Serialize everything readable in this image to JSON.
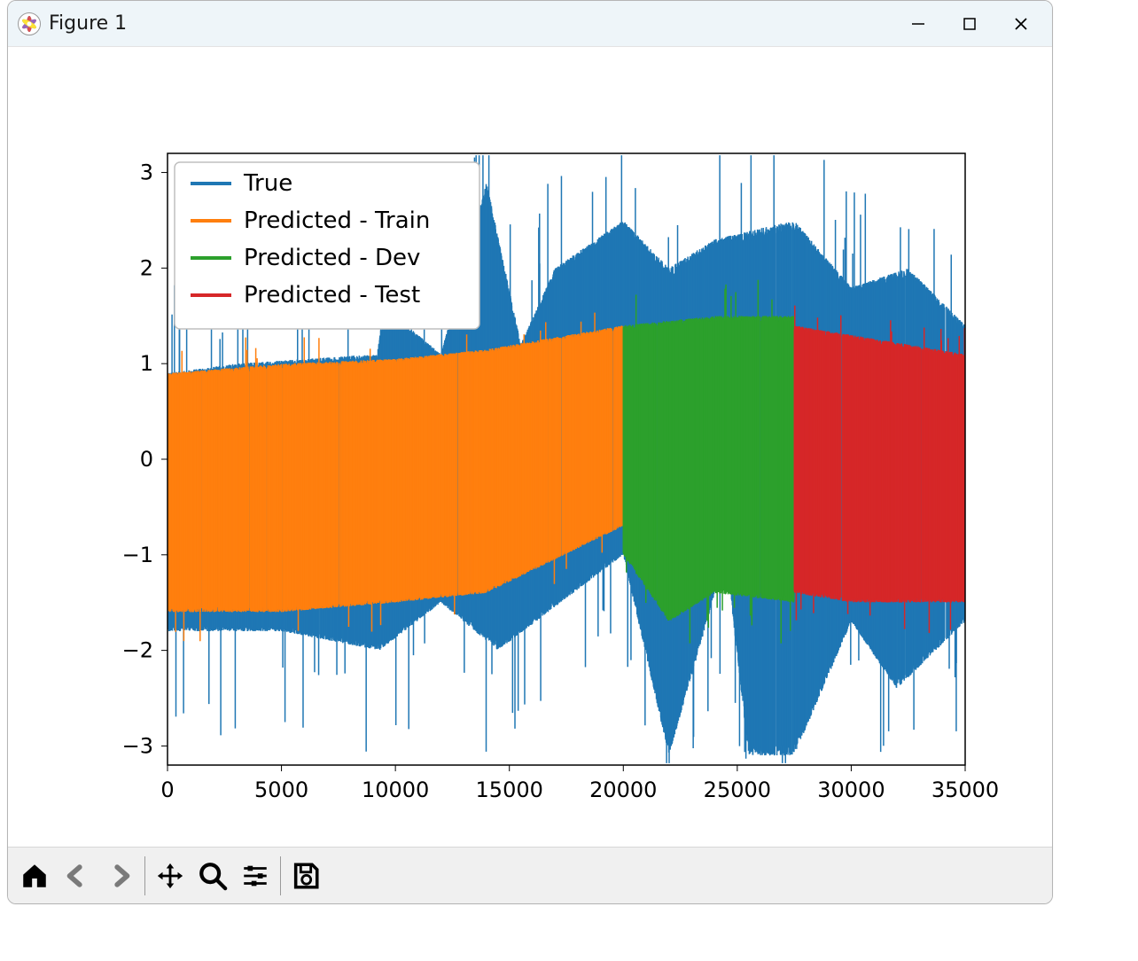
{
  "window": {
    "title": "Figure 1"
  },
  "chart_data": {
    "type": "line",
    "title": "",
    "xlabel": "",
    "ylabel": "",
    "xlim": [
      0,
      35000
    ],
    "ylim": [
      -3.2,
      3.2
    ],
    "xticks": [
      0,
      5000,
      10000,
      15000,
      20000,
      25000,
      30000,
      35000
    ],
    "yticks": [
      -3,
      -2,
      -1,
      0,
      1,
      2,
      3
    ],
    "legend": {
      "position": "upper left",
      "entries": [
        "True",
        "Predicted - Train",
        "Predicted - Dev",
        "Predicted - Test"
      ]
    },
    "series": [
      {
        "name": "True",
        "color": "#1f77b4",
        "x_range": [
          0,
          35000
        ],
        "description": "Dense noisy signal drawn behind the predicted bands",
        "envelope_upper_approx": [
          {
            "x": 0,
            "y": 0.9
          },
          {
            "x": 3000,
            "y": 1.0
          },
          {
            "x": 9200,
            "y": 1.1
          },
          {
            "x": 9500,
            "y": 1.6
          },
          {
            "x": 12000,
            "y": 1.1
          },
          {
            "x": 14000,
            "y": 2.9
          },
          {
            "x": 15500,
            "y": 1.2
          },
          {
            "x": 17000,
            "y": 2.0
          },
          {
            "x": 20000,
            "y": 2.5
          },
          {
            "x": 22000,
            "y": 2.0
          },
          {
            "x": 24000,
            "y": 2.3
          },
          {
            "x": 27500,
            "y": 2.5
          },
          {
            "x": 30000,
            "y": 1.8
          },
          {
            "x": 32500,
            "y": 2.0
          },
          {
            "x": 35000,
            "y": 1.4
          }
        ],
        "envelope_lower_approx": [
          {
            "x": 0,
            "y": -1.8
          },
          {
            "x": 5000,
            "y": -1.8
          },
          {
            "x": 9300,
            "y": -2.0
          },
          {
            "x": 12000,
            "y": -1.5
          },
          {
            "x": 14500,
            "y": -2.0
          },
          {
            "x": 20000,
            "y": -1.0
          },
          {
            "x": 22000,
            "y": -3.1
          },
          {
            "x": 24500,
            "y": -1.0
          },
          {
            "x": 25500,
            "y": -3.1
          },
          {
            "x": 27500,
            "y": -3.1
          },
          {
            "x": 30000,
            "y": -1.7
          },
          {
            "x": 32000,
            "y": -2.4
          },
          {
            "x": 35000,
            "y": -1.7
          }
        ]
      },
      {
        "name": "Predicted - Train",
        "color": "#ff7f0e",
        "x_range": [
          0,
          20000
        ],
        "envelope_upper_approx": [
          {
            "x": 0,
            "y": 0.9
          },
          {
            "x": 5000,
            "y": 1.0
          },
          {
            "x": 10000,
            "y": 1.05
          },
          {
            "x": 14000,
            "y": 1.15
          },
          {
            "x": 20000,
            "y": 1.4
          }
        ],
        "envelope_lower_approx": [
          {
            "x": 0,
            "y": -1.6
          },
          {
            "x": 5000,
            "y": -1.6
          },
          {
            "x": 10000,
            "y": -1.5
          },
          {
            "x": 14000,
            "y": -1.4
          },
          {
            "x": 20000,
            "y": -0.7
          }
        ]
      },
      {
        "name": "Predicted - Dev",
        "color": "#2ca02c",
        "x_range": [
          20000,
          27500
        ],
        "envelope_upper_approx": [
          {
            "x": 20000,
            "y": 1.4
          },
          {
            "x": 24000,
            "y": 1.5
          },
          {
            "x": 27500,
            "y": 1.5
          }
        ],
        "envelope_lower_approx": [
          {
            "x": 20000,
            "y": -1.0
          },
          {
            "x": 22000,
            "y": -1.7
          },
          {
            "x": 24000,
            "y": -1.4
          },
          {
            "x": 27500,
            "y": -1.5
          }
        ]
      },
      {
        "name": "Predicted - Test",
        "color": "#d62728",
        "x_range": [
          27500,
          35000
        ],
        "envelope_upper_approx": [
          {
            "x": 27500,
            "y": 1.4
          },
          {
            "x": 30000,
            "y": 1.3
          },
          {
            "x": 32500,
            "y": 1.2
          },
          {
            "x": 35000,
            "y": 1.1
          }
        ],
        "envelope_lower_approx": [
          {
            "x": 27500,
            "y": -1.4
          },
          {
            "x": 30000,
            "y": -1.5
          },
          {
            "x": 32500,
            "y": -1.5
          },
          {
            "x": 35000,
            "y": -1.5
          }
        ]
      }
    ]
  },
  "colors": {
    "true": "#1f77b4",
    "train": "#ff7f0e",
    "dev": "#2ca02c",
    "test": "#d62728"
  },
  "toolbar": {
    "items": [
      "home",
      "back",
      "forward",
      "pan",
      "zoom",
      "configure",
      "save"
    ]
  }
}
